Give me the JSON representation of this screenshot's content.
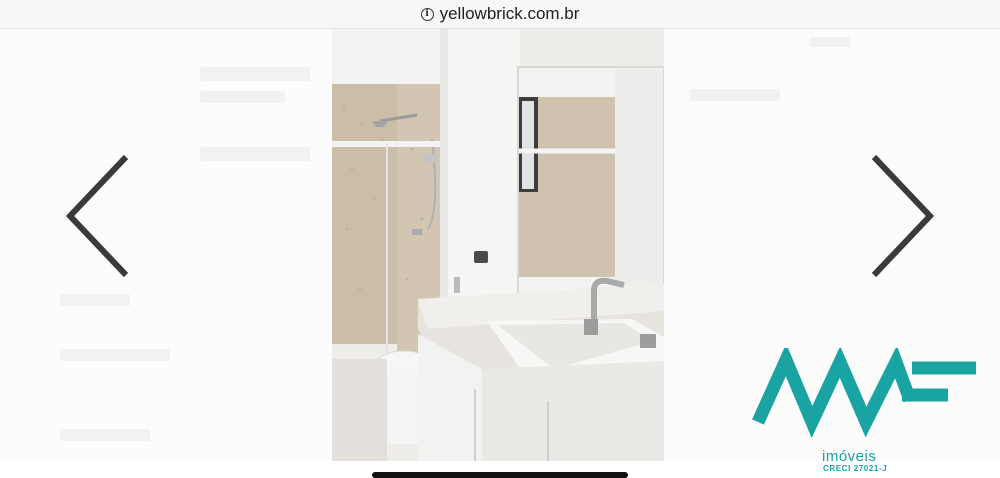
{
  "browser": {
    "url": "yellowbrick.com.br",
    "info_icon": "info-icon"
  },
  "gallery": {
    "prev_icon": "chevron-left-icon",
    "next_icon": "chevron-right-icon",
    "photo_alt": "bathroom-photo"
  },
  "brand": {
    "name": "AMF",
    "subtitle": "imóveis",
    "creci": "CRECI 27021-J",
    "color": "#1aa3a3"
  },
  "colors": {
    "arrow": "#3a3a3a",
    "background": "#ffffff"
  }
}
